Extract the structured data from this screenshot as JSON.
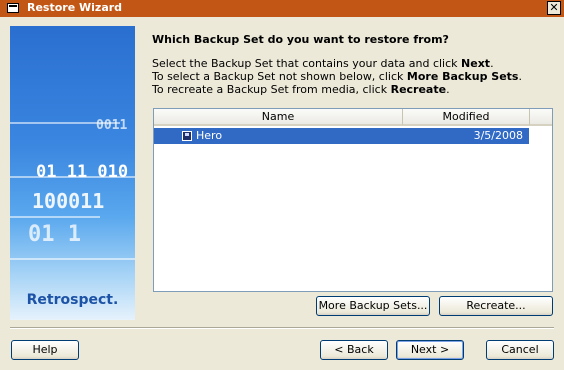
{
  "window": {
    "title": "Restore Wizard",
    "close_label": "✕"
  },
  "sidebar": {
    "logo_text": "Retrospect",
    "logo_mark": ".",
    "art_codes": [
      "0011",
      "01 11 010",
      "100011",
      "01 1"
    ]
  },
  "main": {
    "heading": "Which Backup Set do you want to restore from?",
    "instructions": [
      {
        "pre": "Select the Backup Set that contains your data and click ",
        "bold": "Next",
        "post": "."
      },
      {
        "pre": "To select a Backup Set not shown below, click ",
        "bold": "More Backup Sets",
        "post": "."
      },
      {
        "pre": "To recreate a Backup Set from media, click ",
        "bold": "Recreate",
        "post": "."
      }
    ],
    "list": {
      "columns": [
        "Name",
        "Modified"
      ],
      "rows": [
        {
          "name": "Hero",
          "modified": "3/5/2008",
          "selected": true,
          "icon": "floppy-disk-icon"
        }
      ]
    },
    "more_backup_sets_label": "More Backup Sets...",
    "recreate_label": "Recreate..."
  },
  "footer": {
    "help_label": "Help",
    "back_label": "< Back",
    "next_label": "Next >",
    "cancel_label": "Cancel"
  },
  "colors": {
    "titlebar": "#c25614",
    "selection": "#316ac5",
    "window_bg": "#ece9d8"
  }
}
